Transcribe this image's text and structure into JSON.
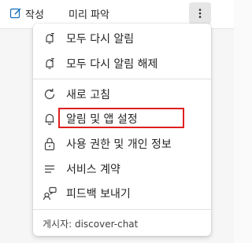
{
  "toolbar": {
    "compose_label": "작성",
    "preview_label": "미리 파악",
    "more_icon": "more-vertical-icon"
  },
  "menu": {
    "items": [
      {
        "label": "모두 다시 알림",
        "icon": "snooze-icon"
      },
      {
        "label": "모두 다시 알림 해제",
        "icon": "snooze-off-icon"
      },
      {
        "label": "새로 고침",
        "icon": "refresh-icon"
      },
      {
        "label": "알림 및 앱 설정",
        "icon": "bell-icon"
      },
      {
        "label": "사용 권한 및 개인 정보",
        "icon": "lock-icon"
      },
      {
        "label": "서비스 계약",
        "icon": "lines-icon"
      },
      {
        "label": "피드백 보내기",
        "icon": "feedback-icon"
      }
    ],
    "publisher": "게시자: discover-chat"
  },
  "colors": {
    "highlight": "#e02020",
    "accent": "#0f6cbd"
  }
}
